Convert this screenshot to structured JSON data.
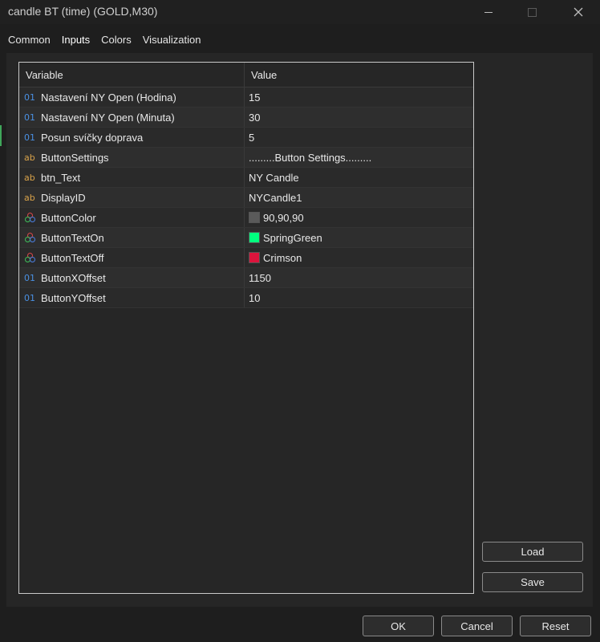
{
  "window": {
    "title": "candle BT (time) (GOLD,M30)"
  },
  "tabs": [
    {
      "label": "Common"
    },
    {
      "label": "Inputs"
    },
    {
      "label": "Colors"
    },
    {
      "label": "Visualization"
    }
  ],
  "table": {
    "headers": {
      "variable": "Variable",
      "value": "Value"
    },
    "rows": [
      {
        "type_icon": "01",
        "variable": "Nastavení NY Open (Hodina)",
        "value": "15"
      },
      {
        "type_icon": "01",
        "variable": "Nastavení NY Open (Minuta)",
        "value": "30"
      },
      {
        "type_icon": "01",
        "variable": "Posun svíčky doprava",
        "value": "5"
      },
      {
        "type_icon": "ab",
        "variable": "ButtonSettings",
        "value": ".........Button Settings........."
      },
      {
        "type_icon": "ab",
        "variable": "btn_Text",
        "value": "NY Candle"
      },
      {
        "type_icon": "ab",
        "variable": "DisplayID",
        "value": "NYCandle1"
      },
      {
        "type_icon": "color",
        "variable": "ButtonColor",
        "value": "90,90,90",
        "swatch": "#5a5a5a"
      },
      {
        "type_icon": "color",
        "variable": "ButtonTextOn",
        "value": "SpringGreen",
        "swatch": "#00ff7f"
      },
      {
        "type_icon": "color",
        "variable": "ButtonTextOff",
        "value": "Crimson",
        "swatch": "#dc143c"
      },
      {
        "type_icon": "01",
        "variable": "ButtonXOffset",
        "value": "1150"
      },
      {
        "type_icon": "01",
        "variable": "ButtonYOffset",
        "value": "10"
      }
    ]
  },
  "buttons": {
    "load": "Load",
    "save": "Save",
    "ok": "OK",
    "cancel": "Cancel",
    "reset": "Reset"
  },
  "colors": {
    "accent": "#3a8ee6",
    "background": "#1e1e1e"
  }
}
